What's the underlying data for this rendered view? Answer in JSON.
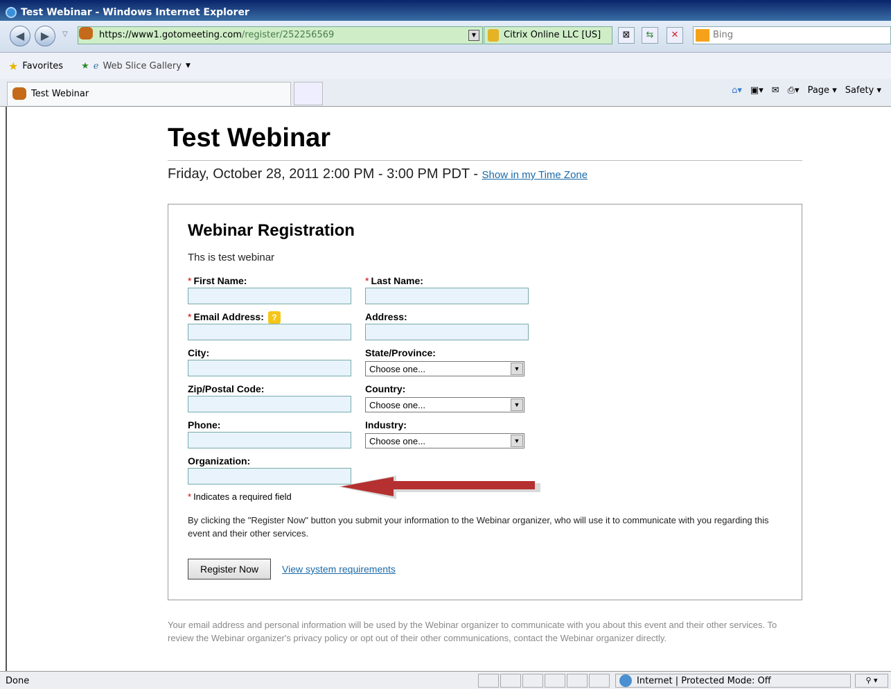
{
  "window": {
    "title": "Test Webinar - Windows Internet Explorer"
  },
  "address": {
    "url_main": "https://www1.gotomeeting.com",
    "url_rest": "/register/252256569",
    "cert": "Citrix Online LLC [US]",
    "search_placeholder": "Bing"
  },
  "favorites": {
    "label": "Favorites",
    "gallery": "Web Slice Gallery"
  },
  "tab": {
    "title": "Test Webinar"
  },
  "commands": {
    "page": "Page",
    "safety": "Safety"
  },
  "page": {
    "title": "Test Webinar",
    "datetime": "Friday, October 28, 2011 2:00 PM - 3:00 PM PDT",
    "tz_link": "Show in my Time Zone"
  },
  "form": {
    "heading": "Webinar Registration",
    "description": "Ths is test webinar",
    "first_name": "First Name:",
    "last_name": "Last Name:",
    "email": "Email Address:",
    "address": "Address:",
    "city": "City:",
    "state": "State/Province:",
    "zip": "Zip/Postal Code:",
    "country": "Country:",
    "phone": "Phone:",
    "industry": "Industry:",
    "organization": "Organization:",
    "select_default": "Choose one...",
    "required_star": "*",
    "required_note": "Indicates a required field",
    "consent": "By clicking the \"Register Now\" button you submit your information to the Webinar organizer, who will use it to communicate with you regarding this event and their other services.",
    "register_button": "Register Now",
    "sysreq_link": "View system requirements"
  },
  "privacy": "Your email address and personal information will be used by the Webinar organizer to communicate with you about this event and their other services. To review the Webinar organizer's privacy policy or opt out of their other communications, contact the Webinar organizer directly.",
  "status": {
    "left": "Done",
    "zone": "Internet | Protected Mode: Off"
  }
}
